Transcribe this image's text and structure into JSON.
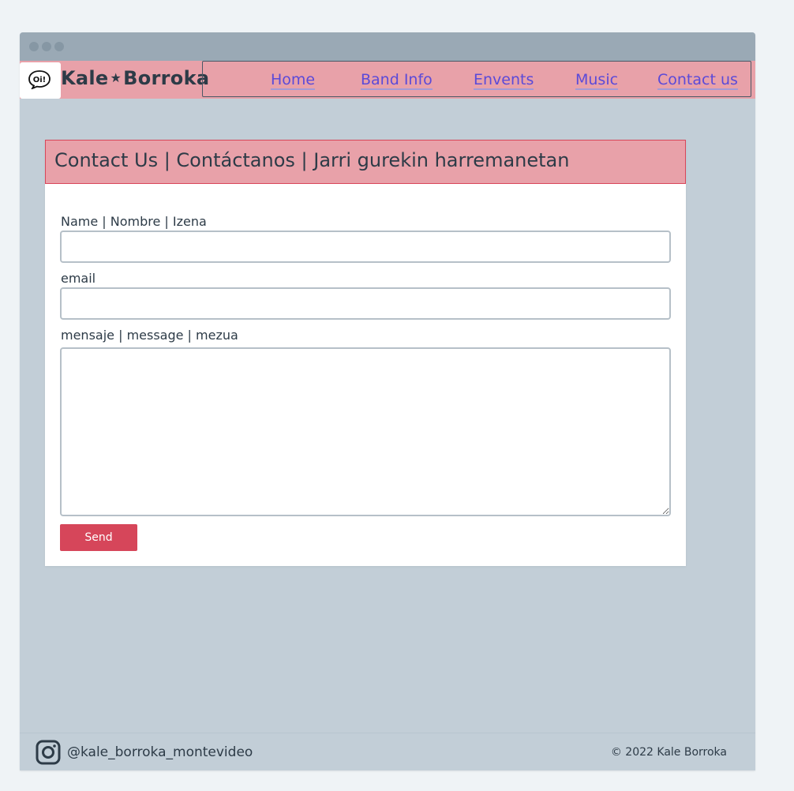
{
  "brand": {
    "name_part1": "Kale",
    "star": "★",
    "name_part2": "Borroka",
    "logo_text": "Oi!"
  },
  "nav": {
    "items": [
      {
        "label": "Home"
      },
      {
        "label": "Band Info"
      },
      {
        "label": "Envents"
      },
      {
        "label": "Music"
      },
      {
        "label": "Contact us"
      }
    ]
  },
  "contact": {
    "title": "Contact Us | Contáctanos | Jarri gurekin harremanetan",
    "name_label": "Name | Nombre | Izena",
    "name_value": "",
    "email_label": "email",
    "email_value": "",
    "message_label": "mensaje | message | mezua",
    "message_value": "",
    "send_label": "Send"
  },
  "footer": {
    "instagram_handle": "@kale_borroka_montevideo",
    "copyright": "© 2022 Kale Borroka"
  },
  "colors": {
    "accent_pink": "#e8a1a9",
    "send_red": "#d6465a",
    "link_purple": "#5b4ad8",
    "page_bg": "#c2ced7"
  }
}
